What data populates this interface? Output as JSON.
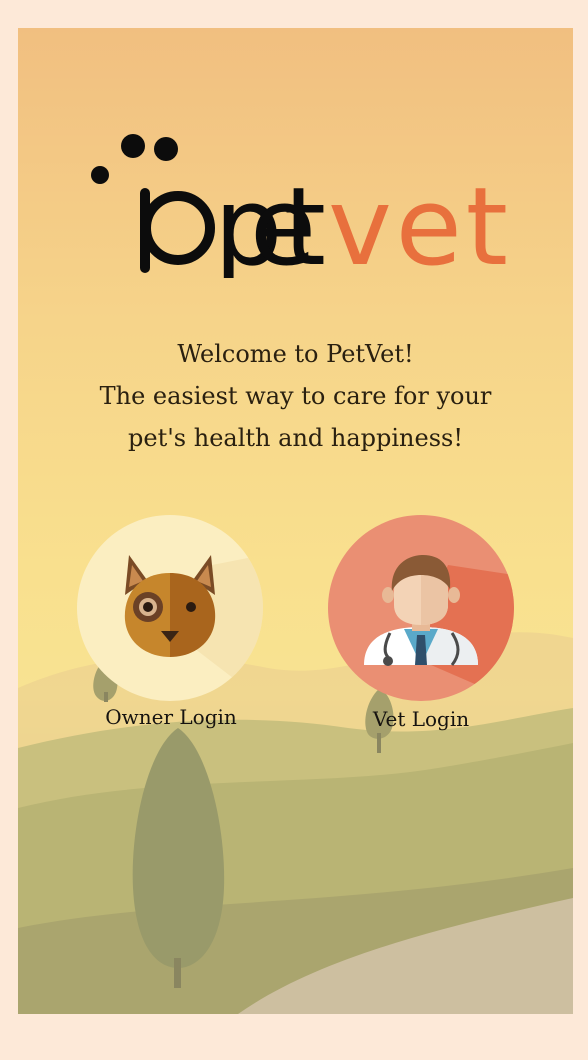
{
  "brand": {
    "part1": "pet",
    "part2": "vet",
    "part1_color": "#0c0c0c",
    "part2_color": "#e8703d"
  },
  "welcome": {
    "line1": "Welcome to PetVet!",
    "line2": "The easiest way to care for your",
    "line3": "pet's health and happiness!"
  },
  "owner_login": {
    "label": "Owner Login",
    "icon": "dog-icon",
    "circle_color": "#fbeec1"
  },
  "vet_login": {
    "label": "Vet Login",
    "icon": "doctor-icon",
    "circle_color": "#ea8f73"
  }
}
